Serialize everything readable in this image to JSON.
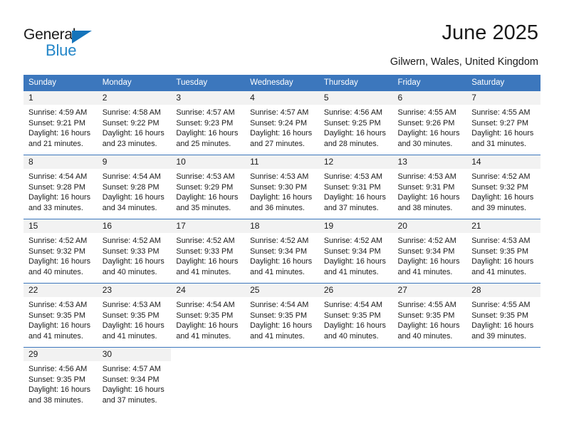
{
  "logo": {
    "word_top": "General",
    "word_bottom": "Blue",
    "triangle_color": "#1574bb",
    "blue_text_color": "#2386c8"
  },
  "header": {
    "title": "June 2025",
    "location": "Gilwern, Wales, United Kingdom"
  },
  "theme": {
    "header_blue": "#3c77bd",
    "daynum_band": "#f2f2f2",
    "text": "#1a1a1a"
  },
  "calendar": {
    "weekday_headers": [
      "Sunday",
      "Monday",
      "Tuesday",
      "Wednesday",
      "Thursday",
      "Friday",
      "Saturday"
    ],
    "labels": {
      "sunrise": "Sunrise:",
      "sunset": "Sunset:",
      "daylight": "Daylight:"
    },
    "weeks": [
      [
        {
          "day": "1",
          "sunrise": "Sunrise: 4:59 AM",
          "sunset": "Sunset: 9:21 PM",
          "daylight": "Daylight: 16 hours and 21 minutes."
        },
        {
          "day": "2",
          "sunrise": "Sunrise: 4:58 AM",
          "sunset": "Sunset: 9:22 PM",
          "daylight": "Daylight: 16 hours and 23 minutes."
        },
        {
          "day": "3",
          "sunrise": "Sunrise: 4:57 AM",
          "sunset": "Sunset: 9:23 PM",
          "daylight": "Daylight: 16 hours and 25 minutes."
        },
        {
          "day": "4",
          "sunrise": "Sunrise: 4:57 AM",
          "sunset": "Sunset: 9:24 PM",
          "daylight": "Daylight: 16 hours and 27 minutes."
        },
        {
          "day": "5",
          "sunrise": "Sunrise: 4:56 AM",
          "sunset": "Sunset: 9:25 PM",
          "daylight": "Daylight: 16 hours and 28 minutes."
        },
        {
          "day": "6",
          "sunrise": "Sunrise: 4:55 AM",
          "sunset": "Sunset: 9:26 PM",
          "daylight": "Daylight: 16 hours and 30 minutes."
        },
        {
          "day": "7",
          "sunrise": "Sunrise: 4:55 AM",
          "sunset": "Sunset: 9:27 PM",
          "daylight": "Daylight: 16 hours and 31 minutes."
        }
      ],
      [
        {
          "day": "8",
          "sunrise": "Sunrise: 4:54 AM",
          "sunset": "Sunset: 9:28 PM",
          "daylight": "Daylight: 16 hours and 33 minutes."
        },
        {
          "day": "9",
          "sunrise": "Sunrise: 4:54 AM",
          "sunset": "Sunset: 9:28 PM",
          "daylight": "Daylight: 16 hours and 34 minutes."
        },
        {
          "day": "10",
          "sunrise": "Sunrise: 4:53 AM",
          "sunset": "Sunset: 9:29 PM",
          "daylight": "Daylight: 16 hours and 35 minutes."
        },
        {
          "day": "11",
          "sunrise": "Sunrise: 4:53 AM",
          "sunset": "Sunset: 9:30 PM",
          "daylight": "Daylight: 16 hours and 36 minutes."
        },
        {
          "day": "12",
          "sunrise": "Sunrise: 4:53 AM",
          "sunset": "Sunset: 9:31 PM",
          "daylight": "Daylight: 16 hours and 37 minutes."
        },
        {
          "day": "13",
          "sunrise": "Sunrise: 4:53 AM",
          "sunset": "Sunset: 9:31 PM",
          "daylight": "Daylight: 16 hours and 38 minutes."
        },
        {
          "day": "14",
          "sunrise": "Sunrise: 4:52 AM",
          "sunset": "Sunset: 9:32 PM",
          "daylight": "Daylight: 16 hours and 39 minutes."
        }
      ],
      [
        {
          "day": "15",
          "sunrise": "Sunrise: 4:52 AM",
          "sunset": "Sunset: 9:32 PM",
          "daylight": "Daylight: 16 hours and 40 minutes."
        },
        {
          "day": "16",
          "sunrise": "Sunrise: 4:52 AM",
          "sunset": "Sunset: 9:33 PM",
          "daylight": "Daylight: 16 hours and 40 minutes."
        },
        {
          "day": "17",
          "sunrise": "Sunrise: 4:52 AM",
          "sunset": "Sunset: 9:33 PM",
          "daylight": "Daylight: 16 hours and 41 minutes."
        },
        {
          "day": "18",
          "sunrise": "Sunrise: 4:52 AM",
          "sunset": "Sunset: 9:34 PM",
          "daylight": "Daylight: 16 hours and 41 minutes."
        },
        {
          "day": "19",
          "sunrise": "Sunrise: 4:52 AM",
          "sunset": "Sunset: 9:34 PM",
          "daylight": "Daylight: 16 hours and 41 minutes."
        },
        {
          "day": "20",
          "sunrise": "Sunrise: 4:52 AM",
          "sunset": "Sunset: 9:34 PM",
          "daylight": "Daylight: 16 hours and 41 minutes."
        },
        {
          "day": "21",
          "sunrise": "Sunrise: 4:53 AM",
          "sunset": "Sunset: 9:35 PM",
          "daylight": "Daylight: 16 hours and 41 minutes."
        }
      ],
      [
        {
          "day": "22",
          "sunrise": "Sunrise: 4:53 AM",
          "sunset": "Sunset: 9:35 PM",
          "daylight": "Daylight: 16 hours and 41 minutes."
        },
        {
          "day": "23",
          "sunrise": "Sunrise: 4:53 AM",
          "sunset": "Sunset: 9:35 PM",
          "daylight": "Daylight: 16 hours and 41 minutes."
        },
        {
          "day": "24",
          "sunrise": "Sunrise: 4:54 AM",
          "sunset": "Sunset: 9:35 PM",
          "daylight": "Daylight: 16 hours and 41 minutes."
        },
        {
          "day": "25",
          "sunrise": "Sunrise: 4:54 AM",
          "sunset": "Sunset: 9:35 PM",
          "daylight": "Daylight: 16 hours and 41 minutes."
        },
        {
          "day": "26",
          "sunrise": "Sunrise: 4:54 AM",
          "sunset": "Sunset: 9:35 PM",
          "daylight": "Daylight: 16 hours and 40 minutes."
        },
        {
          "day": "27",
          "sunrise": "Sunrise: 4:55 AM",
          "sunset": "Sunset: 9:35 PM",
          "daylight": "Daylight: 16 hours and 40 minutes."
        },
        {
          "day": "28",
          "sunrise": "Sunrise: 4:55 AM",
          "sunset": "Sunset: 9:35 PM",
          "daylight": "Daylight: 16 hours and 39 minutes."
        }
      ],
      [
        {
          "day": "29",
          "sunrise": "Sunrise: 4:56 AM",
          "sunset": "Sunset: 9:35 PM",
          "daylight": "Daylight: 16 hours and 38 minutes."
        },
        {
          "day": "30",
          "sunrise": "Sunrise: 4:57 AM",
          "sunset": "Sunset: 9:34 PM",
          "daylight": "Daylight: 16 hours and 37 minutes."
        },
        {
          "day": "",
          "sunrise": "",
          "sunset": "",
          "daylight": ""
        },
        {
          "day": "",
          "sunrise": "",
          "sunset": "",
          "daylight": ""
        },
        {
          "day": "",
          "sunrise": "",
          "sunset": "",
          "daylight": ""
        },
        {
          "day": "",
          "sunrise": "",
          "sunset": "",
          "daylight": ""
        },
        {
          "day": "",
          "sunrise": "",
          "sunset": "",
          "daylight": ""
        }
      ]
    ]
  }
}
